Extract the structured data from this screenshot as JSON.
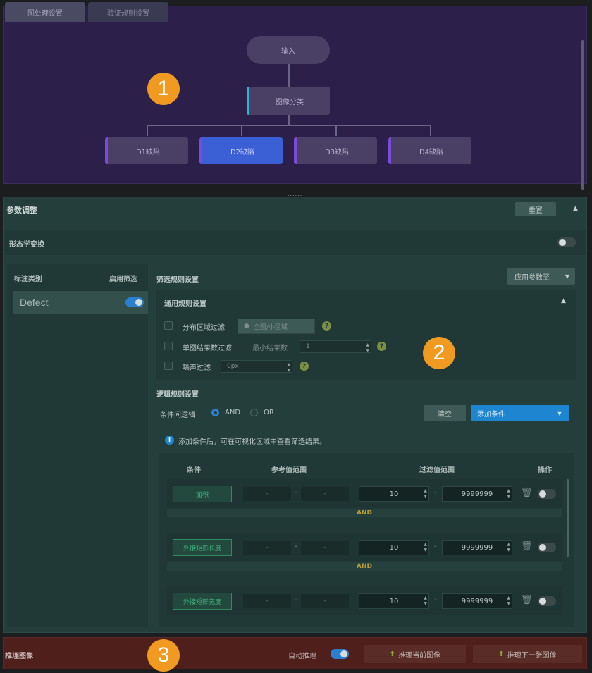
{
  "top_panel": {
    "tabs": [
      {
        "label": "图处理设置",
        "active": true
      },
      {
        "label": "验证规则设置",
        "active": false
      }
    ],
    "flow": {
      "input": "输入",
      "classify": "图像分类",
      "detectors": [
        "D1缺陷",
        "D2缺陷",
        "D3缺陷",
        "D4缺陷"
      ],
      "selected_detector": "D2缺陷"
    }
  },
  "badges": {
    "one": "1",
    "two": "2",
    "three": "3"
  },
  "splitter": "......",
  "param_panel": {
    "title": "参数调整",
    "reset_label": "重置",
    "morph_label": "形态学变换",
    "morph_enabled": false,
    "class_col_header": "标注类别",
    "enable_col_header": "启用筛选",
    "classes": [
      {
        "name": "Defect",
        "enabled": true
      }
    ],
    "filter_settings_title": "筛选规则设置",
    "apply_label": "应用参数至",
    "general_rules_title": "通用规则设置",
    "rules": [
      {
        "label": "分布区域过滤",
        "value": "全图/小区域"
      },
      {
        "label": "单图结果数过滤",
        "sub_label": "最小结果数",
        "value": "1"
      },
      {
        "label": "噪声过滤",
        "value": "0px"
      }
    ],
    "logic_title": "逻辑规则设置",
    "logic_label": "条件间逻辑",
    "logic_options": [
      "AND",
      "OR"
    ],
    "logic_selected": "AND",
    "clear_label": "清空",
    "add_condition_label": "添加条件",
    "hint": "添加条件后，可在可视化区域中查看筛选结果。",
    "table_headers": [
      "条件",
      "参考值范围",
      "过滤值范围",
      "操作"
    ],
    "conditions": [
      {
        "name": "面积",
        "ref_min": "-",
        "ref_max": "-",
        "min": "10",
        "max": "9999999",
        "enabled": false
      },
      {
        "name": "外接矩形长度",
        "ref_min": "-",
        "ref_max": "-",
        "min": "10",
        "max": "9999999",
        "enabled": false
      },
      {
        "name": "外接矩形宽度",
        "ref_min": "-",
        "ref_max": "-",
        "min": "10",
        "max": "9999999",
        "enabled": false
      }
    ],
    "joiner": "AND"
  },
  "bottom_bar": {
    "title": "推理图像",
    "auto_infer_label": "自动推理",
    "auto_infer_enabled": true,
    "infer_current": "推理当前图像",
    "infer_next": "推理下一张图像"
  },
  "colors": {
    "flow_bg": "#2c1f4a",
    "param_bg": "#243e3b",
    "bottom_bg": "#4f1f1c",
    "accent_blue": "#1e86d0",
    "badge_orange": "#f09a22",
    "selected_node": "#3b5fd4"
  }
}
